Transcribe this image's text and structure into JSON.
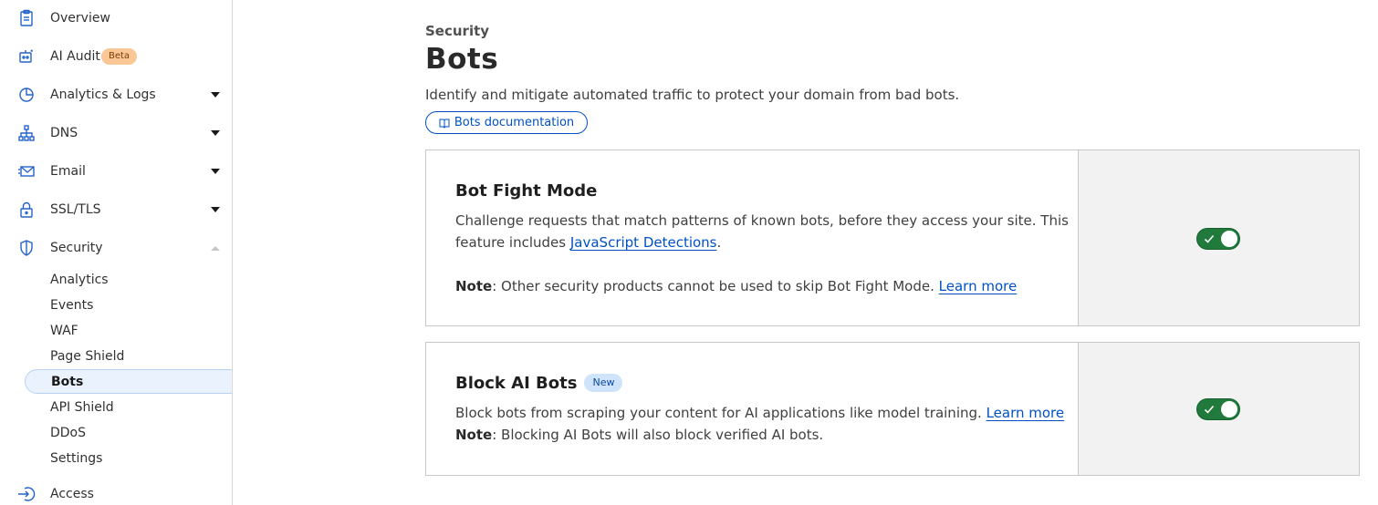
{
  "sidebar": {
    "items": [
      {
        "label": "Overview"
      },
      {
        "label": "AI Audit",
        "badge": "Beta"
      },
      {
        "label": "Analytics & Logs"
      },
      {
        "label": "DNS"
      },
      {
        "label": "Email"
      },
      {
        "label": "SSL/TLS"
      },
      {
        "label": "Security"
      },
      {
        "label": "Access"
      }
    ],
    "security_sub": [
      {
        "label": "Analytics"
      },
      {
        "label": "Events"
      },
      {
        "label": "WAF"
      },
      {
        "label": "Page Shield"
      },
      {
        "label": "Bots"
      },
      {
        "label": "API Shield"
      },
      {
        "label": "DDoS"
      },
      {
        "label": "Settings"
      }
    ],
    "active_item": "Bots"
  },
  "main": {
    "eyebrow": "Security",
    "title": "Bots",
    "description": "Identify and mitigate automated traffic to protect your domain from bad bots.",
    "doc_button": "Bots documentation"
  },
  "cards": [
    {
      "title": "Bot Fight Mode",
      "text_1": "Challenge requests that match patterns of known bots, before they access your site. This",
      "text_2_prefix": "feature includes ",
      "text_2_link": "JavaScript Detections",
      "text_2_suffix": ".",
      "note_label": "Note",
      "note_text": ": Other security products cannot be used to skip Bot Fight Mode. ",
      "note_link": "Learn more",
      "toggle_on": true
    },
    {
      "title": "Block AI Bots",
      "badge": "New",
      "text_1_prefix": "Block bots from scraping your content for AI applications like model training. ",
      "text_1_link": "Learn more",
      "note_label": "Note",
      "note_text": ": Blocking AI Bots will also block verified AI bots.",
      "toggle_on": true
    }
  ],
  "colors": {
    "link": "#0051c3",
    "toggle_on": "#1f7a3c",
    "active_nav_bg": "#eaf2fd",
    "beta_badge": "#fbc797",
    "new_badge": "#cfe3fb"
  }
}
